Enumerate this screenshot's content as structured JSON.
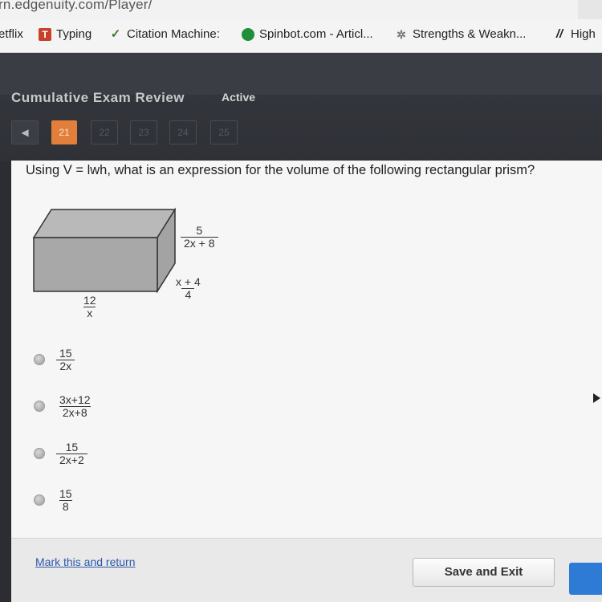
{
  "browser": {
    "url": "rn.edgenuity.com/Player/",
    "bookmarks": [
      {
        "label": "etflix",
        "icon": "netflix-icon"
      },
      {
        "label": "Typing",
        "icon": "typing-icon"
      },
      {
        "label": "Citation Machine:",
        "icon": "citation-machine-icon"
      },
      {
        "label": "Spinbot.com - Articl...",
        "icon": "spinbot-icon"
      },
      {
        "label": "Strengths & Weakn...",
        "icon": "strengths-icon"
      },
      {
        "label": "High",
        "icon": "high-icon"
      }
    ]
  },
  "header": {
    "title": "Cumulative Exam Review",
    "status": "Active",
    "question_nav": [
      "21",
      "22",
      "23",
      "24",
      "25"
    ],
    "active_question": "21"
  },
  "question": {
    "text": "Using V = lwh, what is an expression for the volume of the following rectangular prism?",
    "dimensions": {
      "height": {
        "num": "5",
        "den": "2x + 8"
      },
      "depth": {
        "num": "x + 4",
        "den": "4"
      },
      "length": {
        "num": "12",
        "den": "x"
      }
    }
  },
  "choices": [
    {
      "num": "15",
      "den": "2x"
    },
    {
      "num": "3x+12",
      "den": "2x+8"
    },
    {
      "num": "15",
      "den": "2x+2"
    },
    {
      "num": "15",
      "den": "8"
    }
  ],
  "footer": {
    "mark_link": "Mark this and return",
    "save_button": "Save and Exit"
  },
  "colors": {
    "accent_orange": "#e27f3a",
    "link_blue": "#2d58a8",
    "submit_blue": "#2e7bd6"
  }
}
